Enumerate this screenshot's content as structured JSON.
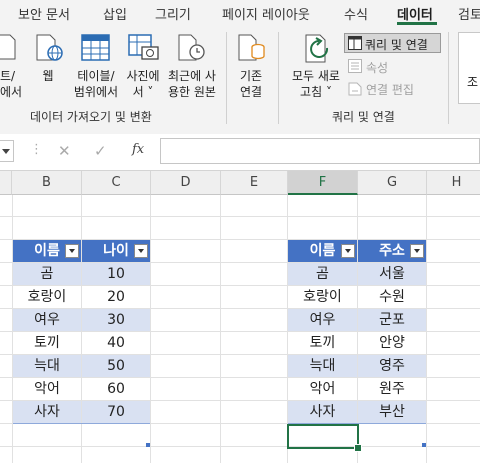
{
  "ribbon_tabs": [
    "보안 문서",
    "삽입",
    "그리기",
    "페이지 레이아웃",
    "수식",
    "데이터",
    "검토"
  ],
  "get_transform": {
    "from_text_line1": "트/",
    "from_text_line2": "에서",
    "web": "웹",
    "from_table_line1": "테이블/",
    "from_table_line2": "범위에서",
    "from_picture_line1": "사진에",
    "from_picture_line2": "서 ˅",
    "recent_sources_line1": "최근에 사",
    "recent_sources_line2": "용한 원본",
    "existing_conn_line1": "기존",
    "existing_conn_line2": "연결",
    "group_label": "데이터 가져오기 및 변환"
  },
  "queries": {
    "refresh_line1": "모두 새로",
    "refresh_line2": "고침 ˅",
    "queries_connections": "쿼리 및 연결",
    "properties": "속성",
    "edit_links": "연결 편집",
    "group_label": "쿼리 및 연결",
    "right_cut": "조"
  },
  "formula_bar": {
    "fx": "fx",
    "cancel": "✕",
    "enter": "✓"
  },
  "columns": [
    "B",
    "C",
    "D",
    "E",
    "F",
    "G",
    "H"
  ],
  "table1": {
    "headers": [
      "이름",
      "나이"
    ],
    "rows": [
      [
        "곰",
        "10"
      ],
      [
        "호랑이",
        "20"
      ],
      [
        "여우",
        "30"
      ],
      [
        "토끼",
        "40"
      ],
      [
        "늑대",
        "50"
      ],
      [
        "악어",
        "60"
      ],
      [
        "사자",
        "70"
      ]
    ]
  },
  "table2": {
    "headers": [
      "이름",
      "주소"
    ],
    "rows": [
      [
        "곰",
        "서울"
      ],
      [
        "호랑이",
        "수원"
      ],
      [
        "여우",
        "군포"
      ],
      [
        "토끼",
        "안양"
      ],
      [
        "늑대",
        "영주"
      ],
      [
        "악어",
        "원주"
      ],
      [
        "사자",
        "부산"
      ]
    ]
  },
  "colors": {
    "accent": "#217346",
    "table_header": "#4472c4",
    "table_band": "#d9e1f2"
  }
}
